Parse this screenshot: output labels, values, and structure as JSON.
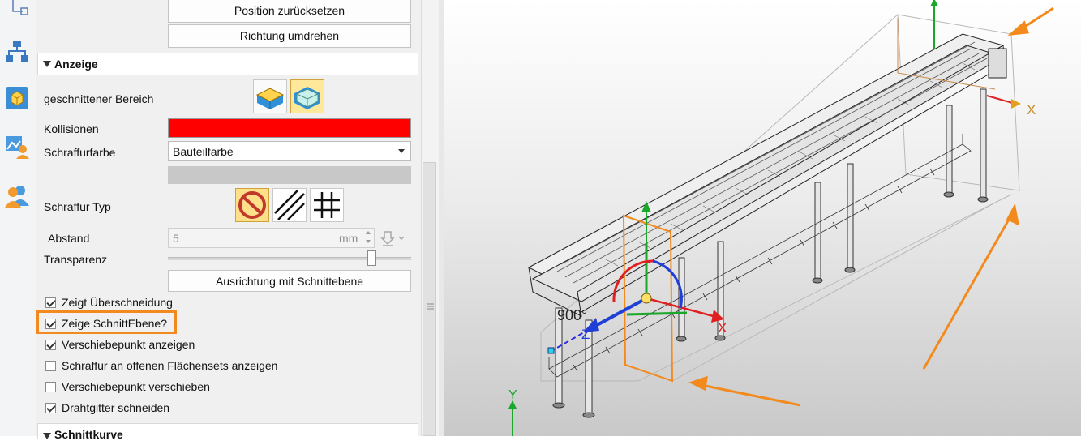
{
  "buttons": {
    "reset_position": "Position zurücksetzen",
    "reverse_direction": "Richtung umdrehen",
    "align_section_plane": "Ausrichtung mit Schnittebene"
  },
  "sections": {
    "display": "Anzeige",
    "section_curve": "Schnittkurve"
  },
  "fields": {
    "cut_area_label": "geschnittener Bereich",
    "collisions_label": "Kollisionen",
    "collisions_color": "#ff0000",
    "hatch_color_label": "Schraffurfarbe",
    "hatch_color_value": "Bauteilfarbe",
    "hatch_type_label": "Schraffur Typ",
    "spacing_label": "Abstand",
    "spacing_value": "5",
    "spacing_unit": "mm",
    "transparency_label": "Transparenz",
    "transparency_level": 0.85
  },
  "checkboxes": [
    {
      "label": "Zeigt Überschneidung",
      "checked": true
    },
    {
      "label": "Zeige SchnittEbene?",
      "checked": true
    },
    {
      "label": "Verschiebepunkt anzeigen",
      "checked": true
    },
    {
      "label": "Schraffur an offenen Flächensets anzeigen",
      "checked": false
    },
    {
      "label": "Verschiebepunkt verschieben",
      "checked": false
    },
    {
      "label": "Drahtgitter schneiden",
      "checked": true
    }
  ],
  "viewport": {
    "axis_x": "X",
    "axis_y": "Y",
    "axis_z": "Z",
    "angle_label": "900°",
    "highlight_color": "#f28a1e"
  },
  "icons": [
    "tree-icon",
    "hierarchy-icon",
    "box-icon",
    "image-user-icon",
    "users-icon",
    "cut-box-icon",
    "cut-box-selected-icon",
    "no-hatch-icon",
    "diagonal-hatch-icon",
    "grid-hatch-icon",
    "spin-up-icon",
    "spin-down-icon",
    "pick-icon",
    "dropdown-arrow-icon"
  ]
}
